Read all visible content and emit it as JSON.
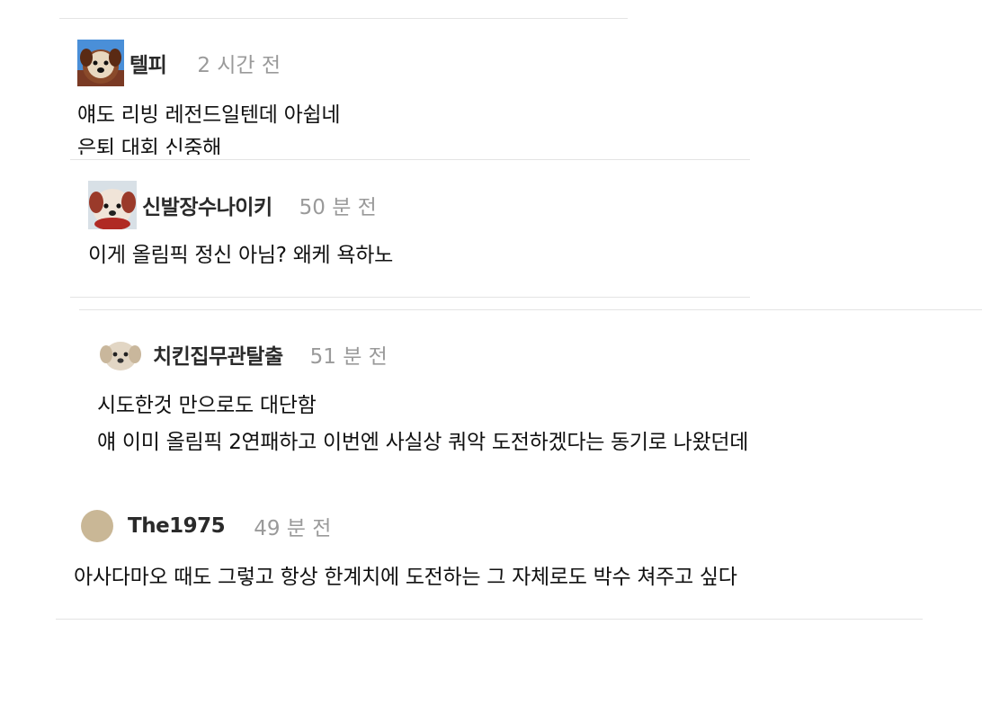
{
  "comments": [
    {
      "user": "텔피",
      "time": "2 시간 전",
      "avatar_icon": "dog-face-icon",
      "lines": [
        "얘도 리빙 레전드일텐데 아쉽네",
        "은퇴 대회 신중해"
      ]
    },
    {
      "user": "신발장수나이키",
      "time": "50 분 전",
      "avatar_icon": "dog-face-icon",
      "lines": [
        "이게 올림픽 정신 아님? 왜케 욕하노"
      ]
    },
    {
      "user": "치킨집무관탈출",
      "time": "51 분 전",
      "avatar_icon": "puppy-icon",
      "lines": [
        "시도한것 만으로도 대단함",
        "얘 이미 올림픽 2연패하고 이번엔 사실상 쿼악 도전하겠다는 동기로 나왔던데"
      ]
    },
    {
      "user": "The1975",
      "time": "49 분 전",
      "avatar_icon": "default-avatar-icon",
      "lines": [
        "아사다마오 때도 그렇고 항상 한계치에 도전하는 그 자체로도 박수 쳐주고 싶다"
      ]
    }
  ],
  "colors": {
    "username": "#2a2a2a",
    "timestamp": "#9a9a9a",
    "separator": "#e4e4e4",
    "default_avatar": "#c9b796"
  }
}
